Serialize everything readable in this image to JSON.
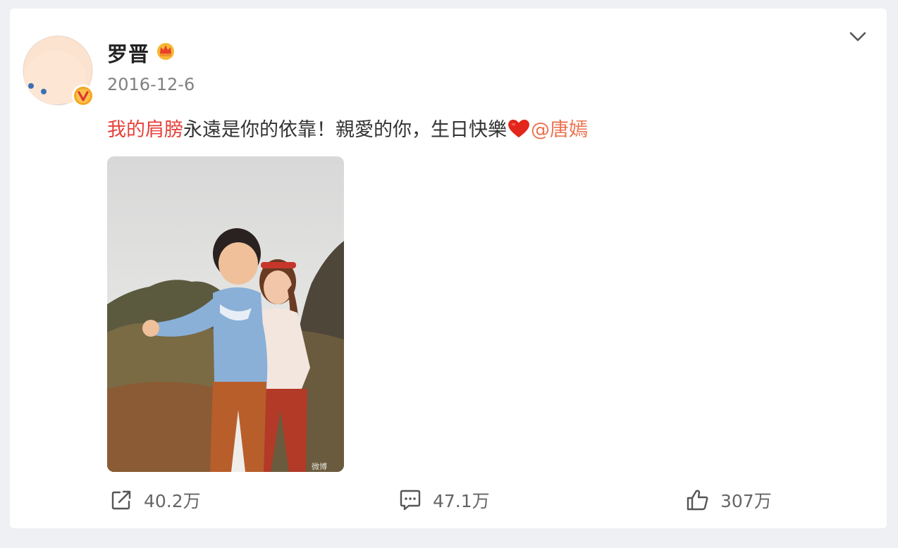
{
  "post": {
    "username": "罗晋",
    "date": "2016-12-6",
    "text_highlight": "我的肩膀",
    "text_body": "永遠是你的依靠！親愛的你，生日快樂",
    "mention": "@唐嫣",
    "heart_icon": "red-heart-emoji",
    "watermark": "微博"
  },
  "actions": {
    "share_count": "40.2万",
    "comment_count": "47.1万",
    "like_count": "307万"
  },
  "colors": {
    "highlight": "#e8403a",
    "mention": "#eb7350",
    "muted": "#808080",
    "verified_badge": "#f5a623"
  }
}
